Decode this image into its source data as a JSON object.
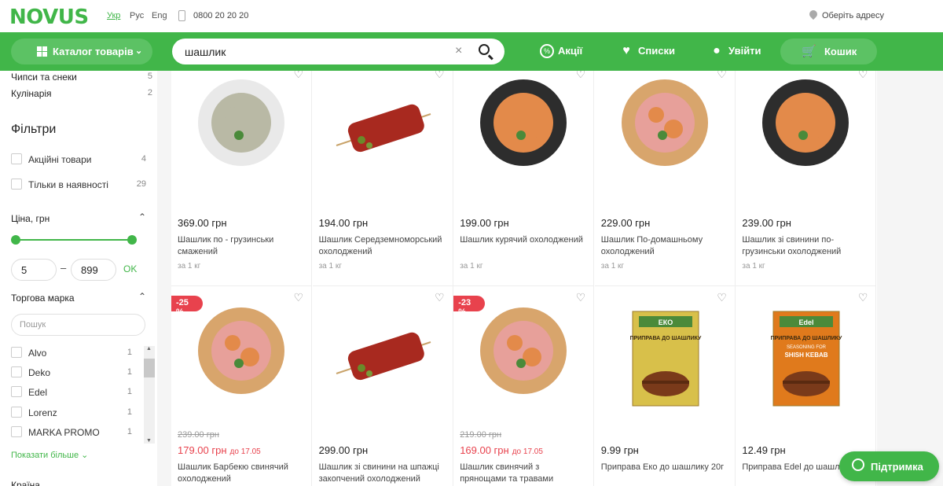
{
  "header": {
    "logo": "NOVUS",
    "languages": [
      "Укр",
      "Рус",
      "Eng"
    ],
    "active_language": "Укр",
    "phone": "0800 20 20 20",
    "address": "Оберіть адресу"
  },
  "nav": {
    "catalog": "Каталог товарів",
    "search_value": "шашлик",
    "promo": "Акції",
    "lists": "Списки",
    "login": "Увійти",
    "cart": "Кошик",
    "accent_color": "#41b649"
  },
  "sidebar": {
    "categories": [
      {
        "label": "Чипси та снеки",
        "count": "5"
      },
      {
        "label": "Кулінарія",
        "count": "2"
      }
    ],
    "filters_title": "Фільтри",
    "checkboxes": [
      {
        "label": "Акційні товари",
        "count": "4"
      },
      {
        "label": "Тільки в наявності",
        "count": "29"
      }
    ],
    "price_title": "Ціна, грн",
    "price_min": "5",
    "price_max": "899",
    "ok": "OK",
    "brand_title": "Торгова марка",
    "brand_search_placeholder": "Пошук",
    "brands": [
      {
        "label": "Alvo",
        "count": "1"
      },
      {
        "label": "Deko",
        "count": "1"
      },
      {
        "label": "Edel",
        "count": "1"
      },
      {
        "label": "Lorenz",
        "count": "1"
      },
      {
        "label": "MARKA PROMO",
        "count": "1"
      }
    ],
    "show_more": "Показати більше",
    "country_title": "Країна"
  },
  "products": [
    {
      "price": "369.00 грн",
      "name": "Шашлик по - грузинськи смажений",
      "unit": "за 1 кг",
      "kind": "plate"
    },
    {
      "price": "194.00 грн",
      "name": "Шашлик Середземноморський охолоджений",
      "unit": "за 1 кг",
      "kind": "skewer"
    },
    {
      "price": "199.00 грн",
      "name": "Шашлик курячий охолоджений",
      "unit": "за 1 кг",
      "kind": "dark"
    },
    {
      "price": "229.00 грн",
      "name": "Шашлик По-домашньому охолоджений",
      "unit": "за 1 кг",
      "kind": "wood"
    },
    {
      "price": "239.00 грн",
      "name": "Шашлик зі свинини по-грузинськи охолоджений",
      "unit": "за 1 кг",
      "kind": "dark"
    },
    {
      "badge": "-25 %",
      "old_price": "239.00 грн",
      "new_price": "179.00 грн",
      "until": "до 17.05",
      "name": "Шашлик Барбекю свинячий охолоджений",
      "kind": "wood"
    },
    {
      "price": "299.00 грн",
      "name": "Шашлик зі свинини на шпажці закопчений охолоджений",
      "kind": "skewer"
    },
    {
      "badge": "-23 %",
      "old_price": "219.00 грн",
      "new_price": "169.00 грн",
      "until": "до 17.05",
      "name": "Шашлик свинячий з прянощами та травами",
      "kind": "wood"
    },
    {
      "price": "9.99 грн",
      "name": "Приправа Еко до шашлику 20г",
      "kind": "packet",
      "packet_brand": "ЕКО",
      "packet_text": "ПРИПРАВА ДО ШАШЛИКУ",
      "packet_color": "#d8c04a"
    },
    {
      "price": "12.49 грн",
      "name": "Приправа Edel до шашлику",
      "kind": "packet",
      "packet_brand": "Edel",
      "packet_text": "ПРИПРАВА ДО ШАШЛИКУ",
      "packet_text_2": "SEASONING FOR",
      "packet_text_3": "SHISH KEBAB",
      "packet_color": "#e07a1c"
    }
  ],
  "support": "Підтримка"
}
